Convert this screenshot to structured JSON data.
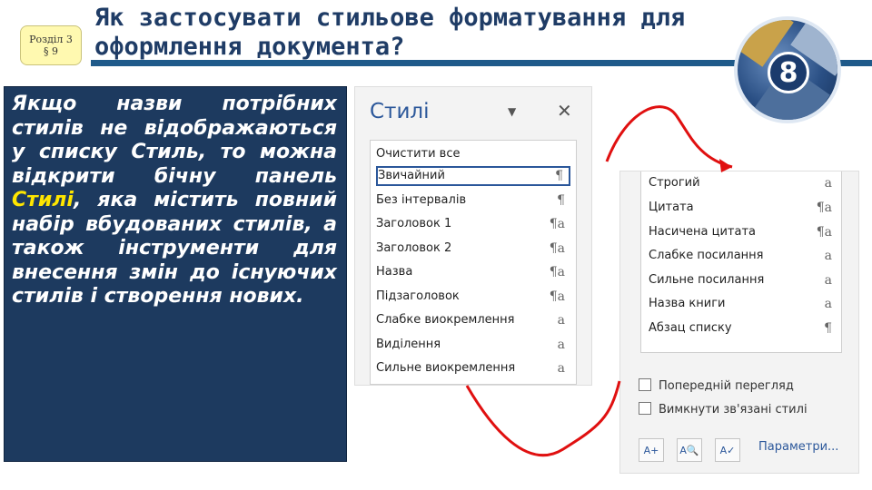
{
  "header": {
    "badge": {
      "line1": "Розділ 3",
      "line2": "§ 9"
    },
    "title": "Як застосувати стильове форматування для оформлення документа?",
    "logo_number": "8"
  },
  "text_panel": {
    "before": "Якщо назви потрібних стилів не відображаються у списку Стиль, то можна відкрити бічну панель ",
    "highlight": "Стилі",
    "after": ", яка містить повний набір вбудованих стилів, а також інструменти для внесення змін до існуючих стилів і створення нових."
  },
  "styles_pane": {
    "title": "Стилі",
    "dropdown_icon": "chevron-down-icon",
    "close_icon": "close-icon",
    "items": [
      {
        "label": "Очистити все",
        "mark": ""
      },
      {
        "label": "Звичайний",
        "mark": "¶"
      },
      {
        "label": "Без інтервалів",
        "mark": "¶"
      },
      {
        "label": "Заголовок 1",
        "mark": "¶a"
      },
      {
        "label": "Заголовок 2",
        "mark": "¶a"
      },
      {
        "label": "Назва",
        "mark": "¶a"
      },
      {
        "label": "Підзаголовок",
        "mark": "¶a"
      },
      {
        "label": "Слабке виокремлення",
        "mark": "a"
      },
      {
        "label": "Виділення",
        "mark": "a"
      },
      {
        "label": "Сильне виокремлення",
        "mark": "a"
      }
    ],
    "selected_index": 1
  },
  "styles_pane_continued": {
    "items": [
      {
        "label": "Строгий",
        "mark": "a"
      },
      {
        "label": "Цитата",
        "mark": "¶a"
      },
      {
        "label": "Насичена цитата",
        "mark": "¶a"
      },
      {
        "label": "Слабке посилання",
        "mark": "a"
      },
      {
        "label": "Сильне посилання",
        "mark": "a"
      },
      {
        "label": "Назва книги",
        "mark": "a"
      },
      {
        "label": "Абзац списку",
        "mark": "¶"
      }
    ],
    "checkboxes": [
      {
        "label": "Попередній перегляд",
        "checked": false
      },
      {
        "label": "Вимкнути зв'язані стилі",
        "checked": false
      }
    ],
    "buttons": [
      {
        "icon": "new-style-icon",
        "glyph": "A+"
      },
      {
        "icon": "style-inspector-icon",
        "glyph": "A🔍"
      },
      {
        "icon": "manage-styles-icon",
        "glyph": "A✓"
      }
    ],
    "options_link": "Параметри..."
  },
  "colors": {
    "title": "#1f3c66",
    "panel_bg": "#1d3a5f",
    "highlight": "#ffe600",
    "accent": "#2b579a",
    "arrow": "#e01010"
  }
}
